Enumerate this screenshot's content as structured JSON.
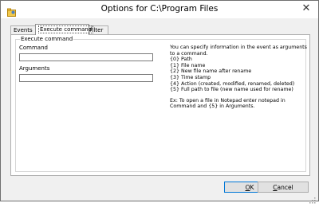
{
  "window": {
    "title": "Options for C:\\Program Files",
    "close_symbol": "✕",
    "app_icon": "application-icon"
  },
  "tabs": [
    {
      "label": "Events",
      "active": false
    },
    {
      "label": "Execute command",
      "active": true
    },
    {
      "label": "Filter",
      "active": false
    }
  ],
  "group": {
    "legend": "Execute command",
    "command_label": "Command",
    "command_value": "",
    "arguments_label": "Arguments",
    "arguments_value": ""
  },
  "info": {
    "lines": [
      "You can specify information in the event as arguments",
      "to a command.",
      "{0} Path",
      "{1} File name",
      "{2} New file name after rename",
      "{3} Time stamp",
      "{4} Action (created, modified, renamed, deleted)",
      "{5} Full path to file (new name used for rename)"
    ],
    "example_lines": [
      "Ex: To open a file in Notepad enter notepad in",
      "Command and {5} in Arguments."
    ]
  },
  "buttons": {
    "ok_accel": "O",
    "ok_rest": "K",
    "cancel_accel": "C",
    "cancel_rest": "ancel"
  },
  "colors": {
    "titlebar": "#ffffff",
    "dialog_bg": "#f0f0f0",
    "default_button_border": "#0078d7"
  }
}
